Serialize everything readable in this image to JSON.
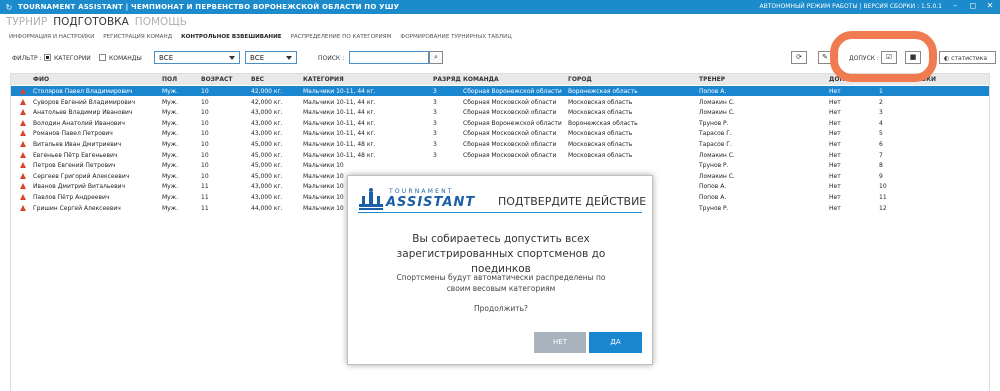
{
  "window": {
    "title": "TOURNAMENT ASSISTANT | ЧЕМПИОНАТ И ПЕРВЕНСТВО ВОРОНЕЖСКОЙ ОБЛАСТИ ПО УШУ",
    "status": "АВТОНОМНЫЙ РЕЖИМ РАБОТЫ | ВЕРСИЯ СБОРКИ : 1.5.0.1",
    "minimize": "–",
    "maximize": "◻",
    "close": "✕"
  },
  "menu": {
    "items": [
      "ТУРНИР",
      "ПОДГОТОВКА",
      "ПОМОЩЬ"
    ],
    "active_index": 1
  },
  "submenu": {
    "items": [
      "ИНФОРМАЦИЯ И НАСТРОЙКИ",
      "РЕГИСТРАЦИЯ КОМАНД",
      "КОНТРОЛЬНОЕ ВЗВЕШИВАНИЕ",
      "РАСПРЕДЕЛЕНИЕ ПО КАТЕГОРИЯМ",
      "ФОРМИРОВАНИЕ ТУРНИРНЫХ ТАБЛИЦ"
    ],
    "active_index": 2
  },
  "toolbar": {
    "filter_label": "ФИЛЬТР :",
    "categories_label": "КАТЕГОРИИ",
    "teams_label": "КОМАНДЫ",
    "select1_value": "ВСЕ",
    "select2_value": "ВСЕ",
    "search_label": "ПОИСК :",
    "search_value": "",
    "search_icon": "⌕",
    "refresh_icon": "⟳",
    "pen_icon": "✎",
    "admission_label": "ДОПУСК :",
    "check_icon": "☑",
    "square_icon": "■",
    "stats_icon": "◐",
    "stats_label": "статистика"
  },
  "table": {
    "headers": [
      "ФИО",
      "ПОЛ",
      "ВОЗРАСТ",
      "ВЕС",
      "КАТЕГОРИЯ",
      "РАЗРЯД",
      "КОМАНДА",
      "ГОРОД",
      "ТРЕНЕР",
      "ДОПУСК",
      "№ ЖЕРЕБЬЕВКИ"
    ],
    "rows": [
      [
        "Столяров Павел Владимирович",
        "Муж.",
        "10",
        "42,000 кг.",
        "Мальчики 10-11, 44 кг.",
        "3",
        "Сборная Воронежской области",
        "Воронежская область",
        "Попов А.",
        "Нет",
        "1"
      ],
      [
        "Суворов Евгений Владимирович",
        "Муж.",
        "10",
        "42,000 кг.",
        "Мальчики 10-11, 44 кг.",
        "3",
        "Сборная Московской области",
        "Московская область",
        "Ломакин С.",
        "Нет",
        "2"
      ],
      [
        "Анатольев Владимир Иванович",
        "Муж.",
        "10",
        "43,000 кг.",
        "Мальчики 10-11, 44 кг.",
        "3",
        "Сборная Московской области",
        "Московская область",
        "Ломакин С.",
        "Нет",
        "3"
      ],
      [
        "Володин Анатолий Иванович",
        "Муж.",
        "10",
        "43,000 кг.",
        "Мальчики 10-11, 44 кг.",
        "3",
        "Сборная Воронежской области",
        "Воронежская область",
        "Трунов Р.",
        "Нет",
        "4"
      ],
      [
        "Романов Павел Петрович",
        "Муж.",
        "10",
        "43,000 кг.",
        "Мальчики 10-11, 44 кг.",
        "3",
        "Сборная Московской области",
        "Московская область",
        "Тарасов Г.",
        "Нет",
        "5"
      ],
      [
        "Витальев Иван Дмитриевич",
        "Муж.",
        "10",
        "45,000 кг.",
        "Мальчики 10-11, 48 кг.",
        "3",
        "Сборная Московской области",
        "Московская область",
        "Тарасов Г.",
        "Нет",
        "6"
      ],
      [
        "Евгеньев Пётр Евгеньевич",
        "Муж.",
        "10",
        "45,000 кг.",
        "Мальчики 10-11, 48 кг.",
        "3",
        "Сборная Московской области",
        "Московская область",
        "Ломакин С.",
        "Нет",
        "7"
      ],
      [
        "Петров Евгений Петрович",
        "Муж.",
        "10",
        "45,000 кг.",
        "Мальчики 10",
        "",
        "",
        "",
        "Трунов Р.",
        "Нет",
        "8"
      ],
      [
        "Сергеев Григорий Алексеевич",
        "Муж.",
        "10",
        "45,000 кг.",
        "Мальчики 10",
        "",
        "",
        "",
        "Ломакин С.",
        "Нет",
        "9"
      ],
      [
        "Иванов Дмитрий Витальевич",
        "Муж.",
        "11",
        "43,000 кг.",
        "Мальчики 10",
        "",
        "",
        "",
        "Попов А.",
        "Нет",
        "10"
      ],
      [
        "Павлов Пётр Андреевич",
        "Муж.",
        "11",
        "43,000 кг.",
        "Мальчики 10",
        "",
        "",
        "",
        "Попов А.",
        "Нет",
        "11"
      ],
      [
        "Гришин Сергей Алексеевич",
        "Муж.",
        "11",
        "44,000 кг.",
        "Мальчики 10",
        "",
        "",
        "",
        "Трунов Р.",
        "Нет",
        "12"
      ]
    ]
  },
  "modal": {
    "logo_small": "TOURNAMENT",
    "logo_big": "ASSISTANT",
    "title": "ПОДТВЕРДИТЕ ДЕЙСТВИЕ",
    "message": "Вы собираетесь допустить всех зарегистрированных спортсменов до поединков",
    "submessage": "Спортсмены будут автоматически распределены по своим весовым категориям",
    "question": "Продолжить?",
    "no_label": "НЕТ",
    "yes_label": "ДА"
  },
  "colors": {
    "accent": "#1b8bcb",
    "highlight": "#f07b50",
    "warning": "#d9432f"
  }
}
